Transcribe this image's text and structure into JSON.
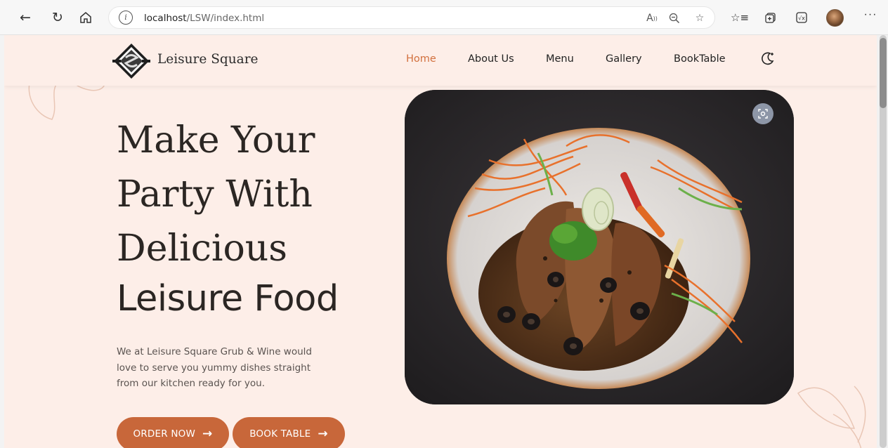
{
  "browser": {
    "url_prefix": "",
    "url_host": "localhost",
    "url_path": "/LSW/index.html",
    "info_glyph": "i",
    "read_aloud": "A",
    "more": "···"
  },
  "site": {
    "brand": "Leisure Square",
    "nav": [
      {
        "label": "Home",
        "active": true
      },
      {
        "label": "About Us",
        "active": false
      },
      {
        "label": "Menu",
        "active": false
      },
      {
        "label": "Gallery",
        "active": false
      },
      {
        "label": "BookTable",
        "active": false
      }
    ],
    "accent_color": "#d2703e",
    "button_color": "#c8673a",
    "background_color": "#fdeee8"
  },
  "hero": {
    "title_line1": "Make Your",
    "title_line2": "Party With",
    "title_line3": "Delicious",
    "title_line4": "Leisure Food",
    "description": "We at Leisure Square Grub & Wine would love to serve you yummy dishes straight from our kitchen ready for you.",
    "order_button": "ORDER NOW",
    "book_button": "BOOK TABLE"
  },
  "icons": {
    "back": "back-arrow-icon",
    "refresh": "refresh-icon",
    "home": "home-icon",
    "theme": "moon-icon",
    "arrow": "arrow-right-icon"
  }
}
